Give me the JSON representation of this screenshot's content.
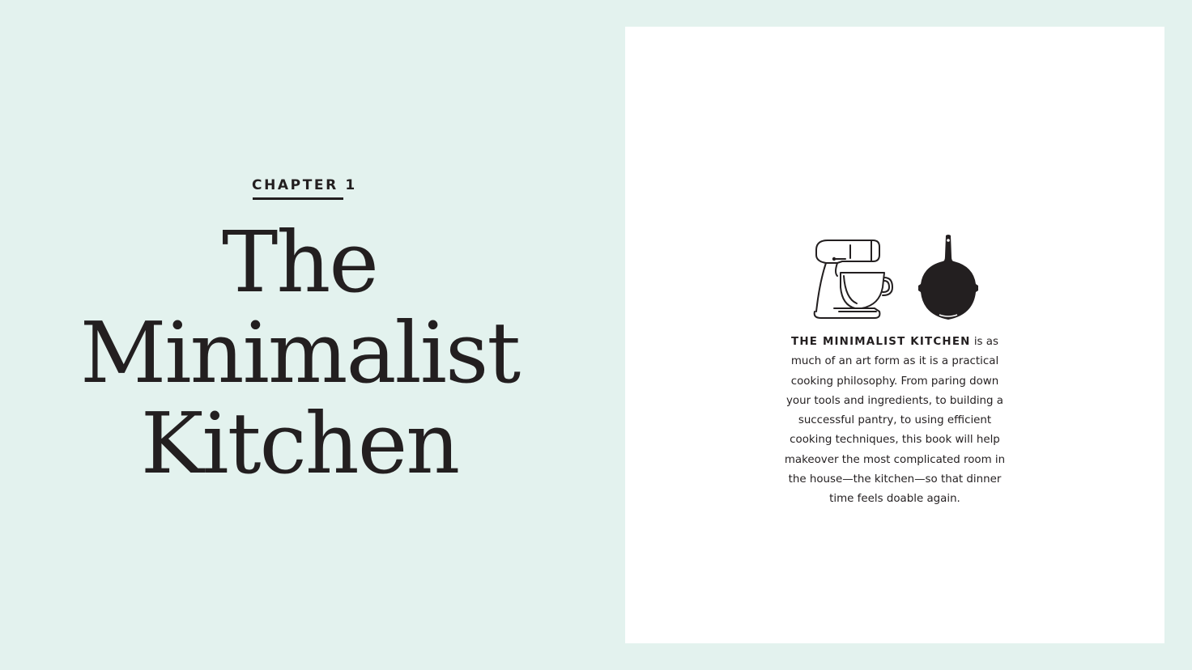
{
  "left_page": {
    "chapter_label": "CHAPTER 1",
    "title_lines": [
      "The",
      "Minimalist",
      "Kitchen"
    ]
  },
  "right_page": {
    "icons": [
      "stand-mixer-icon",
      "cast-iron-skillet-icon"
    ],
    "lead_text": "THE MINIMALIST KITCHEN",
    "body_text": " is as much of an art form as it is a practical cooking philosophy. From paring down your tools and ingredients, to building a successful pantry, to using efficient cooking techniques, this book will help makeover the most complicated room in the house—the kitchen—so that dinner time feels doable again."
  },
  "colors": {
    "page_background": "#e3f2ee",
    "panel_background": "#ffffff",
    "ink": "#231f20"
  }
}
